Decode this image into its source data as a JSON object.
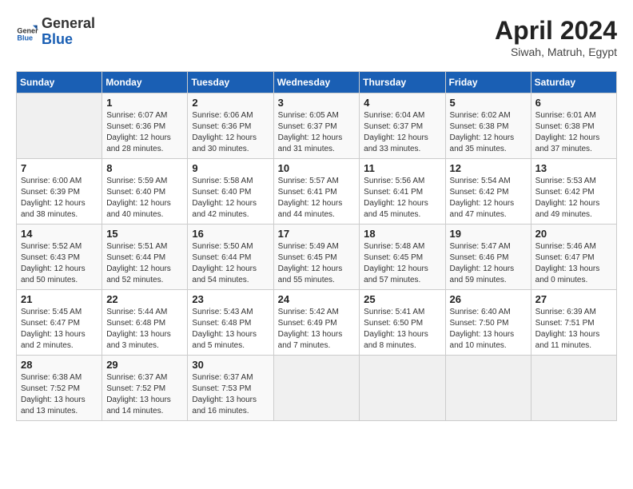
{
  "logo": {
    "line1": "General",
    "line2": "Blue"
  },
  "title": "April 2024",
  "subtitle": "Siwah, Matruh, Egypt",
  "days_header": [
    "Sunday",
    "Monday",
    "Tuesday",
    "Wednesday",
    "Thursday",
    "Friday",
    "Saturday"
  ],
  "weeks": [
    [
      {
        "day": "",
        "info": ""
      },
      {
        "day": "1",
        "info": "Sunrise: 6:07 AM\nSunset: 6:36 PM\nDaylight: 12 hours\nand 28 minutes."
      },
      {
        "day": "2",
        "info": "Sunrise: 6:06 AM\nSunset: 6:36 PM\nDaylight: 12 hours\nand 30 minutes."
      },
      {
        "day": "3",
        "info": "Sunrise: 6:05 AM\nSunset: 6:37 PM\nDaylight: 12 hours\nand 31 minutes."
      },
      {
        "day": "4",
        "info": "Sunrise: 6:04 AM\nSunset: 6:37 PM\nDaylight: 12 hours\nand 33 minutes."
      },
      {
        "day": "5",
        "info": "Sunrise: 6:02 AM\nSunset: 6:38 PM\nDaylight: 12 hours\nand 35 minutes."
      },
      {
        "day": "6",
        "info": "Sunrise: 6:01 AM\nSunset: 6:38 PM\nDaylight: 12 hours\nand 37 minutes."
      }
    ],
    [
      {
        "day": "7",
        "info": "Sunrise: 6:00 AM\nSunset: 6:39 PM\nDaylight: 12 hours\nand 38 minutes."
      },
      {
        "day": "8",
        "info": "Sunrise: 5:59 AM\nSunset: 6:40 PM\nDaylight: 12 hours\nand 40 minutes."
      },
      {
        "day": "9",
        "info": "Sunrise: 5:58 AM\nSunset: 6:40 PM\nDaylight: 12 hours\nand 42 minutes."
      },
      {
        "day": "10",
        "info": "Sunrise: 5:57 AM\nSunset: 6:41 PM\nDaylight: 12 hours\nand 44 minutes."
      },
      {
        "day": "11",
        "info": "Sunrise: 5:56 AM\nSunset: 6:41 PM\nDaylight: 12 hours\nand 45 minutes."
      },
      {
        "day": "12",
        "info": "Sunrise: 5:54 AM\nSunset: 6:42 PM\nDaylight: 12 hours\nand 47 minutes."
      },
      {
        "day": "13",
        "info": "Sunrise: 5:53 AM\nSunset: 6:42 PM\nDaylight: 12 hours\nand 49 minutes."
      }
    ],
    [
      {
        "day": "14",
        "info": "Sunrise: 5:52 AM\nSunset: 6:43 PM\nDaylight: 12 hours\nand 50 minutes."
      },
      {
        "day": "15",
        "info": "Sunrise: 5:51 AM\nSunset: 6:44 PM\nDaylight: 12 hours\nand 52 minutes."
      },
      {
        "day": "16",
        "info": "Sunrise: 5:50 AM\nSunset: 6:44 PM\nDaylight: 12 hours\nand 54 minutes."
      },
      {
        "day": "17",
        "info": "Sunrise: 5:49 AM\nSunset: 6:45 PM\nDaylight: 12 hours\nand 55 minutes."
      },
      {
        "day": "18",
        "info": "Sunrise: 5:48 AM\nSunset: 6:45 PM\nDaylight: 12 hours\nand 57 minutes."
      },
      {
        "day": "19",
        "info": "Sunrise: 5:47 AM\nSunset: 6:46 PM\nDaylight: 12 hours\nand 59 minutes."
      },
      {
        "day": "20",
        "info": "Sunrise: 5:46 AM\nSunset: 6:47 PM\nDaylight: 13 hours\nand 0 minutes."
      }
    ],
    [
      {
        "day": "21",
        "info": "Sunrise: 5:45 AM\nSunset: 6:47 PM\nDaylight: 13 hours\nand 2 minutes."
      },
      {
        "day": "22",
        "info": "Sunrise: 5:44 AM\nSunset: 6:48 PM\nDaylight: 13 hours\nand 3 minutes."
      },
      {
        "day": "23",
        "info": "Sunrise: 5:43 AM\nSunset: 6:48 PM\nDaylight: 13 hours\nand 5 minutes."
      },
      {
        "day": "24",
        "info": "Sunrise: 5:42 AM\nSunset: 6:49 PM\nDaylight: 13 hours\nand 7 minutes."
      },
      {
        "day": "25",
        "info": "Sunrise: 5:41 AM\nSunset: 6:50 PM\nDaylight: 13 hours\nand 8 minutes."
      },
      {
        "day": "26",
        "info": "Sunrise: 6:40 AM\nSunset: 7:50 PM\nDaylight: 13 hours\nand 10 minutes."
      },
      {
        "day": "27",
        "info": "Sunrise: 6:39 AM\nSunset: 7:51 PM\nDaylight: 13 hours\nand 11 minutes."
      }
    ],
    [
      {
        "day": "28",
        "info": "Sunrise: 6:38 AM\nSunset: 7:52 PM\nDaylight: 13 hours\nand 13 minutes."
      },
      {
        "day": "29",
        "info": "Sunrise: 6:37 AM\nSunset: 7:52 PM\nDaylight: 13 hours\nand 14 minutes."
      },
      {
        "day": "30",
        "info": "Sunrise: 6:37 AM\nSunset: 7:53 PM\nDaylight: 13 hours\nand 16 minutes."
      },
      {
        "day": "",
        "info": ""
      },
      {
        "day": "",
        "info": ""
      },
      {
        "day": "",
        "info": ""
      },
      {
        "day": "",
        "info": ""
      }
    ]
  ]
}
